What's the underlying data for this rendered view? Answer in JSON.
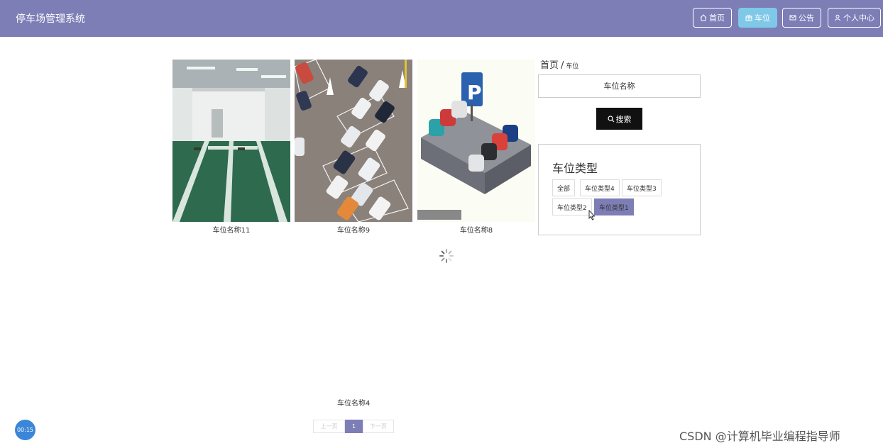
{
  "header": {
    "title": "停车场管理系统"
  },
  "nav": [
    {
      "label": "首页",
      "icon": "home-icon"
    },
    {
      "label": "车位",
      "icon": "parking-icon",
      "active": true
    },
    {
      "label": "公告",
      "icon": "mail-icon"
    },
    {
      "label": "个人中心",
      "icon": "user-icon"
    }
  ],
  "cards": [
    {
      "name": "车位名称11"
    },
    {
      "name": "车位名称9"
    },
    {
      "name": "车位名称8"
    }
  ],
  "breadcrumb": {
    "home": "首页",
    "sep": "/",
    "current": "车位"
  },
  "search": {
    "placeholder": "车位名称",
    "button": "搜索"
  },
  "types": {
    "title": "车位类型",
    "tags": [
      "全部",
      "车位类型4",
      "车位类型3",
      "车位类型2",
      "车位类型1"
    ],
    "active": "车位类型1"
  },
  "bottom_item": "车位名称4",
  "pagination": {
    "prev": "上一页",
    "page": "1",
    "next": "下一页"
  },
  "timer": "00:15",
  "watermark": "CSDN @计算机毕业编程指导师",
  "colors": {
    "header": "#7d7eb6",
    "active_nav": "#7fc8e8",
    "search_button": "#111111"
  }
}
